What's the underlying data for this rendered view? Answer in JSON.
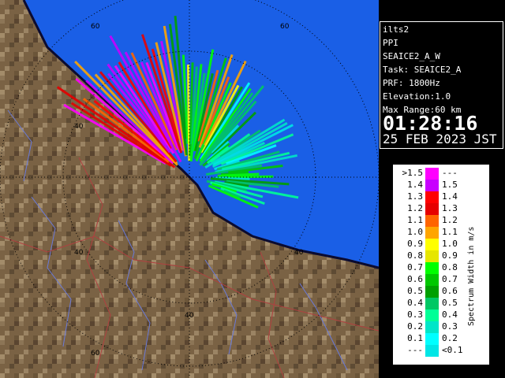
{
  "info": {
    "station": "ilts2",
    "scan_type": "PPI",
    "mode": "SEAICE2_A_W",
    "task": "Task: SEAICE2_A",
    "prf": "PRF: 1800Hz",
    "elevation": "Elevation:1.0",
    "max_range": "Max Range:60 km",
    "time": "01:28:16",
    "date": "25 FEB 2023 JST"
  },
  "map": {
    "range_labels": [
      "60",
      "60",
      "40",
      "40",
      "40",
      "40",
      "60"
    ],
    "colors": {
      "sea": "#1a5fe6",
      "land": "#7a6244",
      "coast": "#0b0b30",
      "ring": "#000000"
    }
  },
  "legend": {
    "title": "Spectrum Width in m/s",
    "left_labels": [
      ">1.5",
      "1.4",
      "1.3",
      "1.2",
      "1.1",
      "1.0",
      "0.9",
      "0.8",
      "0.7",
      "0.6",
      "0.5",
      "0.4",
      "0.3",
      "0.2",
      "0.1",
      "---"
    ],
    "right_labels": [
      "---",
      "1.5",
      "1.4",
      "1.3",
      "1.2",
      "1.1",
      "1.0",
      "0.9",
      "0.8",
      "0.7",
      "0.6",
      "0.5",
      "0.4",
      "0.3",
      "0.2",
      "<0.1"
    ],
    "colors": [
      "#ff00ff",
      "#c800ff",
      "#ff0000",
      "#e60000",
      "#ff6400",
      "#ffa500",
      "#ffff00",
      "#e6e600",
      "#00ff00",
      "#00c800",
      "#00a000",
      "#00c864",
      "#00ff96",
      "#00e6c8",
      "#00ffff",
      "#00e6e6"
    ]
  }
}
